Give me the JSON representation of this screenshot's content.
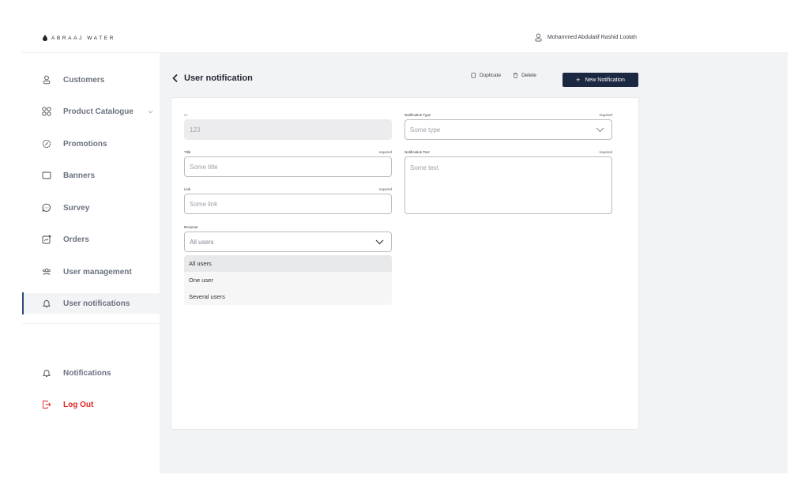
{
  "header": {
    "brand": "ABRAAJ WATER",
    "user_name": "Mohammed Abdulatif Rashid Lootah"
  },
  "sidebar": {
    "items": [
      {
        "label": "Customers",
        "icon": "user-icon"
      },
      {
        "label": "Product Catalogue",
        "icon": "grid-icon",
        "has_chevron": true
      },
      {
        "label": "Promotions",
        "icon": "badge-percent-icon"
      },
      {
        "label": "Banners",
        "icon": "banner-icon"
      },
      {
        "label": "Survey",
        "icon": "chat-bubble-icon"
      },
      {
        "label": "Orders",
        "icon": "orders-chart-icon"
      },
      {
        "label": "User management",
        "icon": "users-group-icon"
      },
      {
        "label": "User notifications",
        "icon": "bell-icon",
        "active": true
      }
    ],
    "bottom_items": [
      {
        "label": "Notifications",
        "icon": "bell-icon"
      },
      {
        "label": "Log Out",
        "icon": "logout-icon"
      }
    ]
  },
  "page": {
    "title": "User notification",
    "actions": {
      "duplicate": "Duplicate",
      "delete": "Delete",
      "new": "New Notification",
      "new_icon": "+"
    }
  },
  "form": {
    "id": {
      "label": "ID",
      "value": "123"
    },
    "title": {
      "label": "Title",
      "required": "required",
      "placeholder": "Some title"
    },
    "link": {
      "label": "Link",
      "required": "required",
      "placeholder": "Some link"
    },
    "receiver": {
      "label": "Reciever",
      "value": "All users",
      "options": [
        "All users",
        "One user",
        "Several users"
      ],
      "selected_index": 0
    },
    "notification_type": {
      "label": "Notification Type",
      "required": "required",
      "placeholder": "Some type"
    },
    "notification_text": {
      "label": "Notification Text",
      "required": "required",
      "placeholder": "Some text"
    }
  },
  "colors": {
    "accent": "#1c2841",
    "active_indicator": "#2c4a80",
    "logout": "#e02424",
    "main_bg": "#f2f3f5"
  }
}
